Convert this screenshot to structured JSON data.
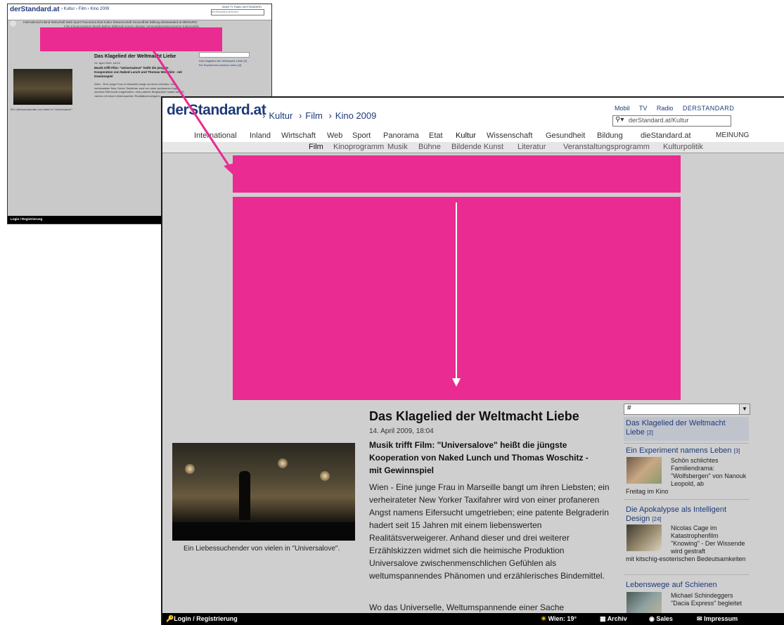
{
  "site": {
    "logo": "derStandard.at",
    "breadcrumb": [
      "Kultur",
      "Film",
      "Kino 2009"
    ],
    "breadcrumb_sep": "›"
  },
  "top_links": [
    "Mobil",
    "TV",
    "Radio",
    "DERSTANDARD"
  ],
  "search": {
    "value": "derStandard.at/Kultur",
    "icon": "search-icon"
  },
  "nav_main": [
    "International",
    "Inland",
    "Wirtschaft",
    "Web",
    "Sport",
    "Panorama",
    "Etat",
    "Kultur",
    "Wissenschaft",
    "Gesundheit",
    "Bildung",
    "dieStandard.at",
    "MEINUNG"
  ],
  "nav_sub": [
    "Film",
    "Kinoprogramm",
    "Musik",
    "Bühne",
    "Bildende Kunst",
    "Literatur",
    "Veranstaltungsprogramm",
    "Kulturpolitik"
  ],
  "article": {
    "title": "Das Klagelied der Weltmacht Liebe",
    "date": "14. April 2009, 18:04",
    "lead": "Musik trifft Film: \"Universalove\" heißt die jüngste Kooperation von Naked Lunch und Thomas Woschitz - mit Gewinnspiel",
    "body": "Wien - Eine junge Frau in Marseille bangt um ihren Liebsten; ein verheirateter New Yorker Taxifahrer wird von einer profaneren Angst namens Eifersucht umgetrieben; eine patente Belgraderin hadert seit 15 Jahren mit einem liebenswerten Realitätsverweigerer. Anhand dieser und drei weiterer Erzählskizzen widmet sich die heimische Produktion Universalove zwischenmenschlichen Gefühlen als weltumspannendes Phänomen und erzählerisches Bindemittel.",
    "body_next": "Wo das Universelle, Weltumspannende einer Sache",
    "image_caption": "Ein Liebessuchender von vielen in \"Universalove\"."
  },
  "sidebar": {
    "select_value": "#",
    "items": [
      {
        "title": "Das Klagelied der Weltmacht Liebe",
        "count": "[2]"
      },
      {
        "title": "Ein Experiment namens Leben",
        "count": "[3]",
        "snippet": "Schön schlichtes Familiendrama: \"Wolfsbergen\" von Nanouk Leopold, ab",
        "tail": "Freitag im Kino"
      },
      {
        "title": "Die Apokalypse als Intelligent Design",
        "count": "[24]",
        "snippet": "Nicolas Cage im Katastrophenfilm \"Knowing\" - Der Wissende wird gestraft",
        "tail": "mit kitschig-esoterischen Bedeutsamkeiten"
      },
      {
        "title": "Lebenswege auf Schienen",
        "count": "",
        "snippet": "Michael Schindeggers \"Dacia Express\" begleitet"
      }
    ]
  },
  "footer": {
    "login": "Login / Registrierung",
    "weather": "Wien: 19°",
    "archiv": "Archiv",
    "sales": "Sales",
    "impressum": "Impressum"
  },
  "thumbnail": {
    "logo": "derStandard.at",
    "breadcrumb": "› Kultur › Film › Kino 2009",
    "top_links": "Mobil  TV  Radio  derSTANDARD",
    "search_value": "derStandard.at/Kultur",
    "nav_main": "International  Inland  Wirtschaft  Web  Sport  Panorama  Etat  Kultur  Wissenschaft  Gesundheit  Bildung  dieStandard.at  MEINUNG",
    "nav_sub": "Film  Kinoprogramm  Musik  Bühne  Bildende Kunst  Literatur  Veranstaltungsprogramm  Kulturpolitik",
    "title": "Das Klagelied der Weltmacht Liebe",
    "date": "14. April 2009, 18:04",
    "lead": "Musik trifft Film: \"Universalove\" heißt die jüngste Kooperation von Naked Lunch und Thomas Woschitz - mit Gewinnspiel",
    "body": "Wien - Eine junge Frau in Marseille bangt um ihren Liebsten; ein verheirateter New Yorker Taxifahrer wird von einer profaneren Angst namens Eifersucht umgetrieben; eine patente Belgraderin hadert seit 15 Jahren mit einem liebenswerten Realitätsverweigerer.",
    "caption": "Ein Liebessuchender von vielen in \"Universalove\".",
    "side1": "Das Klagelied der Weltmacht Liebe [2]",
    "side2": "Ein Experiment namens Leben [3]",
    "footer": "Login / Registrierung"
  },
  "colors": {
    "accent": "#ea2b92",
    "link": "#1f3a7a",
    "footer": "#000000"
  }
}
